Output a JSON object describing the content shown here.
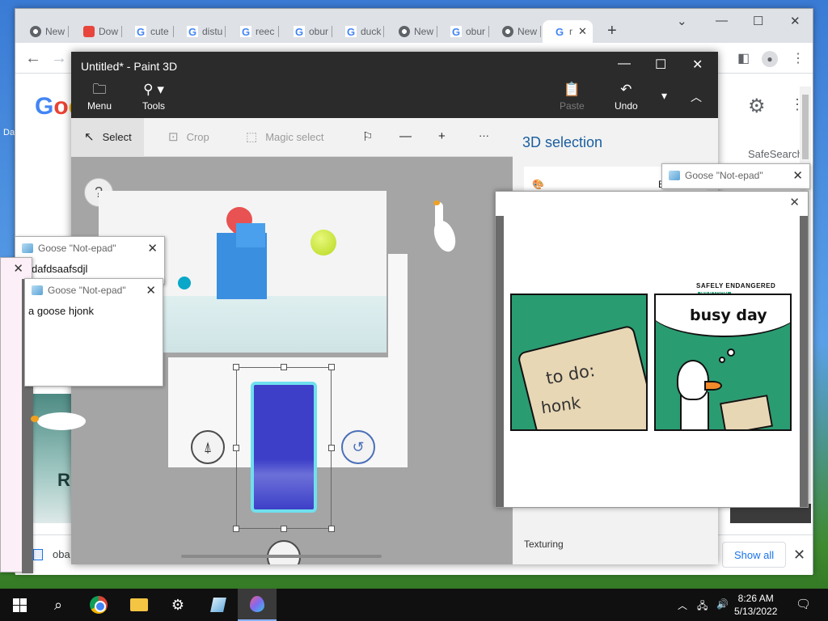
{
  "chrome": {
    "tabs": [
      {
        "label": "New",
        "icon": "chrome-icon"
      },
      {
        "label": "Dow",
        "icon": "download-site-icon"
      },
      {
        "label": "cute",
        "icon": "google-icon"
      },
      {
        "label": "distu",
        "icon": "google-icon"
      },
      {
        "label": "reec",
        "icon": "google-icon"
      },
      {
        "label": "obur",
        "icon": "google-icon"
      },
      {
        "label": "duck",
        "icon": "google-icon"
      },
      {
        "label": "New",
        "icon": "chrome-icon"
      },
      {
        "label": "obur",
        "icon": "google-icon"
      },
      {
        "label": "New",
        "icon": "chrome-icon"
      },
      {
        "label": "r",
        "icon": "google-icon"
      }
    ],
    "safesearch": "SafeSearch",
    "thumb_text": "R",
    "download_file": "oba",
    "show_all": "Show all"
  },
  "paint": {
    "title": "Untitled* - Paint 3D",
    "menu_label": "Menu",
    "tools_label": "Tools",
    "paste_label": "Paste",
    "undo_label": "Undo",
    "toolbar": {
      "select": "Select",
      "crop": "Crop",
      "magic_select": "Magic select",
      "more": "···"
    },
    "help": "?",
    "panel_title": "3D selection",
    "edit_color": "Edit color",
    "texturing": "Texturing"
  },
  "notes": [
    {
      "title": "Goose \"Not-epad\"",
      "body": "dafdsaafsdjl"
    },
    {
      "title": "Goose \"Not-epad\"",
      "body": "a goose hjonk"
    },
    {
      "title": "Goose \"Not-epad\"",
      "body": ""
    }
  ],
  "comic": {
    "header": "SAFELY ENDANGERED",
    "header_tag": "WEBTOON",
    "todo_line1": "to do:",
    "todo_line2": "honk",
    "bubble": "busy day"
  },
  "taskbar": {
    "time": "8:26 AM",
    "date": "5/13/2022"
  },
  "desktop_label": "Da"
}
